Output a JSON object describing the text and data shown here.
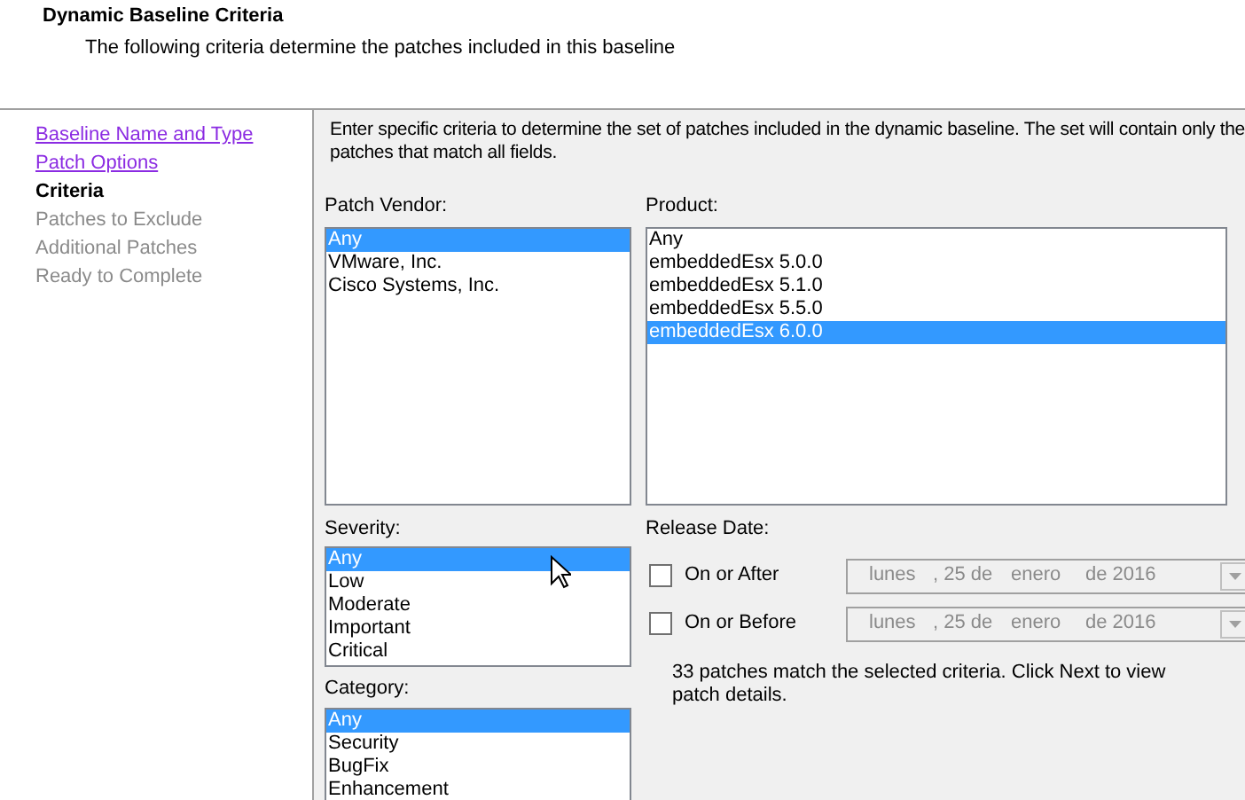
{
  "header": {
    "title": "Dynamic Baseline Criteria",
    "subtitle": "The following criteria determine the patches included in this baseline"
  },
  "nav": [
    {
      "label": "Baseline Name and Type",
      "kind": "link"
    },
    {
      "label": "Patch Options",
      "kind": "link"
    },
    {
      "label": "Criteria",
      "kind": "current"
    },
    {
      "label": "Patches to Exclude",
      "kind": "disabled"
    },
    {
      "label": "Additional Patches",
      "kind": "disabled"
    },
    {
      "label": "Ready to Complete",
      "kind": "disabled"
    }
  ],
  "intro": "Enter specific criteria to determine the set of patches included in the dynamic baseline.  The set will contain only the patches that match all fields.",
  "patch_vendor": {
    "label": "Patch Vendor:",
    "items": [
      {
        "label": "Any",
        "selected": true
      },
      {
        "label": "VMware, Inc.",
        "selected": false
      },
      {
        "label": "Cisco Systems, Inc.",
        "selected": false
      }
    ]
  },
  "product": {
    "label": "Product:",
    "items": [
      {
        "label": "Any",
        "selected": false
      },
      {
        "label": "embeddedEsx 5.0.0",
        "selected": false
      },
      {
        "label": "embeddedEsx 5.1.0",
        "selected": false
      },
      {
        "label": "embeddedEsx 5.5.0",
        "selected": false
      },
      {
        "label": "embeddedEsx 6.0.0",
        "selected": true
      }
    ]
  },
  "severity": {
    "label": "Severity:",
    "items": [
      {
        "label": "Any",
        "selected": true
      },
      {
        "label": "Low",
        "selected": false
      },
      {
        "label": "Moderate",
        "selected": false
      },
      {
        "label": "Important",
        "selected": false
      },
      {
        "label": "Critical",
        "selected": false
      }
    ]
  },
  "category": {
    "label": "Category:",
    "items": [
      {
        "label": "Any",
        "selected": true
      },
      {
        "label": "Security",
        "selected": false
      },
      {
        "label": "BugFix",
        "selected": false
      },
      {
        "label": "Enhancement",
        "selected": false
      }
    ]
  },
  "release_date": {
    "label": "Release Date:",
    "rows": [
      {
        "label": "On or After",
        "checked": false,
        "disabled": true,
        "parts": [
          "lunes",
          ", 25 de",
          "enero",
          "de 2016"
        ]
      },
      {
        "label": "On or Before",
        "checked": false,
        "disabled": true,
        "parts": [
          "lunes",
          ", 25 de",
          "enero",
          "de 2016"
        ]
      }
    ]
  },
  "match_message": "33 patches match the selected criteria. Click Next to view patch details."
}
